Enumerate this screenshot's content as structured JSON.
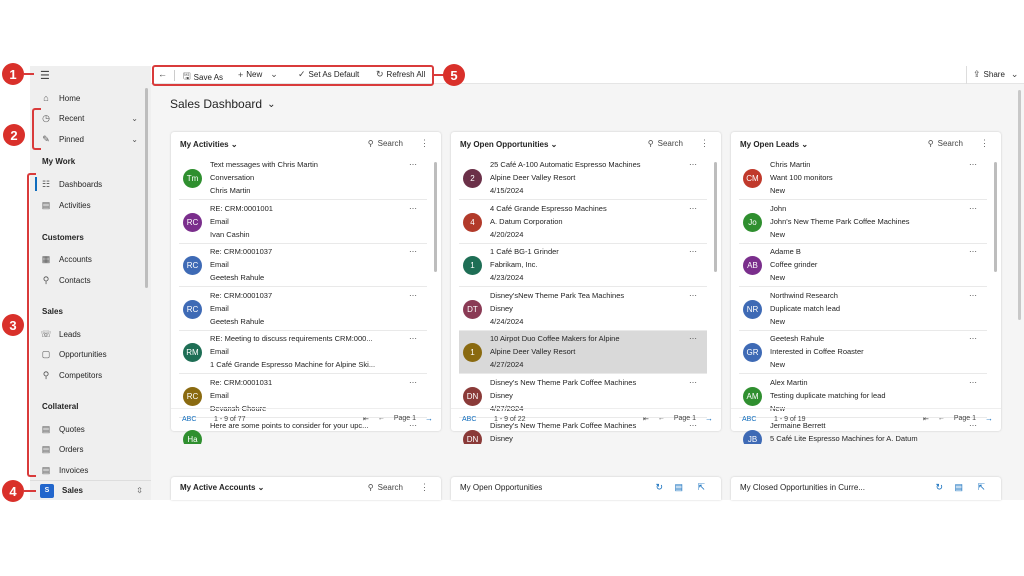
{
  "callouts": [
    "1",
    "2",
    "3",
    "4",
    "5"
  ],
  "nav": {
    "menu_icon": "hamburger-icon",
    "home": "Home",
    "recent": "Recent",
    "pinned": "Pinned",
    "my_work": "My Work",
    "dashboards": "Dashboards",
    "activities": "Activities",
    "customers": "Customers",
    "accounts": "Accounts",
    "contacts": "Contacts",
    "sales": "Sales",
    "leads": "Leads",
    "opportunities": "Opportunities",
    "competitors": "Competitors",
    "collateral": "Collateral",
    "quotes": "Quotes",
    "orders": "Orders",
    "invoices": "Invoices",
    "area_badge": "S",
    "area": "Sales"
  },
  "toolbar": {
    "save_as": "Save As",
    "new": "New",
    "set_default": "Set As Default",
    "refresh_all": "Refresh All",
    "share": "Share"
  },
  "dashboard_title": "Sales Dashboard",
  "search_label": "Search",
  "card1": {
    "title": "My Activities",
    "count": "1 - 9 of 77",
    "page": "Page 1",
    "abc": "ABC",
    "rows": [
      {
        "initials": "Tm",
        "color": "#2f8f2f",
        "l1": "Text messages with Chris Martin",
        "l2": "Conversation",
        "l3": "Chris Martin"
      },
      {
        "initials": "RC",
        "color": "#7a2e8c",
        "l1": "RE: CRM:0001001",
        "l2": "Email",
        "l3": "Ivan Cashin"
      },
      {
        "initials": "RC",
        "color": "#3e6ab5",
        "l1": "Re: CRM:0001037",
        "l2": "Email",
        "l3": "Geetesh Rahule"
      },
      {
        "initials": "RC",
        "color": "#3e6ab5",
        "l1": "Re: CRM:0001037",
        "l2": "Email",
        "l3": "Geetesh Rahule"
      },
      {
        "initials": "RM",
        "color": "#1e6e55",
        "l1": "RE: Meeting to discuss requirements CRM:000...",
        "l2": "Email",
        "l3": "1 Café Grande Espresso Machine for Alpine Ski..."
      },
      {
        "initials": "RC",
        "color": "#8a6a10",
        "l1": "Re: CRM:0001031",
        "l2": "Email",
        "l3": "Devansh Choure"
      },
      {
        "initials": "Ha",
        "color": "#2f8f2f",
        "l1": "Here are some points to consider for your upc...",
        "l2": "",
        "l3": ""
      }
    ]
  },
  "card2": {
    "title": "My Open Opportunities",
    "count": "1 - 9 of 22",
    "page": "Page 1",
    "abc": "ABC",
    "rows": [
      {
        "initials": "2",
        "color": "#6b3048",
        "l1": "25 Café A-100 Automatic Espresso Machines",
        "l2": "Alpine Deer Valley Resort",
        "l3": "4/15/2024"
      },
      {
        "initials": "4",
        "color": "#b23a2a",
        "l1": "4 Café Grande Espresso Machines",
        "l2": "A. Datum Corporation",
        "l3": "4/20/2024"
      },
      {
        "initials": "1",
        "color": "#1e6e55",
        "l1": "1 Café BG-1 Grinder",
        "l2": "Fabrikam, Inc.",
        "l3": "4/23/2024"
      },
      {
        "initials": "DT",
        "color": "#8a3a55",
        "l1": "Disney'sNew Theme Park Tea Machines",
        "l2": "Disney",
        "l3": "4/24/2024"
      },
      {
        "initials": "1",
        "color": "#8a6a10",
        "l1": "10 Airpot Duo Coffee Makers for Alpine",
        "l2": "Alpine Deer Valley Resort",
        "l3": "4/27/2024"
      },
      {
        "initials": "DN",
        "color": "#8a3a38",
        "l1": "Disney's New Theme Park Coffee Machines",
        "l2": "Disney",
        "l3": "4/27/2024"
      },
      {
        "initials": "DN",
        "color": "#8a3a38",
        "l1": "Disney's New Theme Park Coffee Machines",
        "l2": "Disney",
        "l3": ""
      }
    ]
  },
  "card3": {
    "title": "My Open Leads",
    "count": "1 - 9 of 19",
    "page": "Page 1",
    "abc": "ABC",
    "rows": [
      {
        "initials": "CM",
        "color": "#c0392b",
        "l1": "Chris Martin",
        "l2": "Want 100 monitors",
        "l3": "New"
      },
      {
        "initials": "Jo",
        "color": "#2f8f2f",
        "l1": "John",
        "l2": "John's New Theme Park Coffee Machines",
        "l3": "New"
      },
      {
        "initials": "AB",
        "color": "#7a2e8c",
        "l1": "Adame B",
        "l2": "Coffee grinder",
        "l3": "New"
      },
      {
        "initials": "NR",
        "color": "#3e6ab5",
        "l1": "Northwind Research",
        "l2": "Duplicate match lead",
        "l3": "New"
      },
      {
        "initials": "GR",
        "color": "#3e6ab5",
        "l1": "Geetesh Rahule",
        "l2": "Interested in Coffee Roaster",
        "l3": "New"
      },
      {
        "initials": "AM",
        "color": "#2f8f2f",
        "l1": "Alex Martin",
        "l2": "Testing duplicate matching for lead",
        "l3": "New"
      },
      {
        "initials": "JB",
        "color": "#3e6ab5",
        "l1": "Jermaine Berrett",
        "l2": "5 Café Lite Espresso Machines for A. Datum",
        "l3": ""
      }
    ]
  },
  "card4": {
    "title": "My Active Accounts"
  },
  "card5": {
    "title": "My Open Opportunities"
  },
  "card6": {
    "title": "My Closed Opportunities in Curre..."
  },
  "colors": {
    "accent": "#0f6cbd",
    "callout": "#d9302a"
  }
}
